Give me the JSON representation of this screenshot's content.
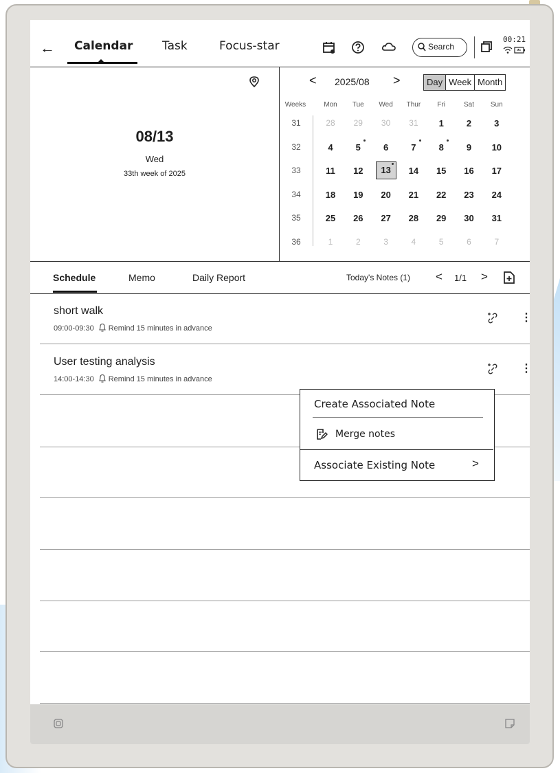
{
  "nav": {
    "back_glyph": "←",
    "tabs": [
      {
        "label": "Calendar",
        "active": true
      },
      {
        "label": "Task",
        "active": false
      },
      {
        "label": "Focus-star",
        "active": false
      }
    ],
    "icons": [
      "calendar-add-icon",
      "help-icon",
      "sync-cloud-icon"
    ],
    "search_label": "Search",
    "time": "00:21",
    "status_icons": [
      "wifi-icon",
      "battery-icon"
    ]
  },
  "selected_date": {
    "date": "08/13",
    "weekday": "Wed",
    "week_of": "33th week of 2025"
  },
  "calendar": {
    "month_label": "2025/08",
    "prev_glyph": "<",
    "next_glyph": ">",
    "views": [
      "Day",
      "Week",
      "Month"
    ],
    "active_view": "Day",
    "weeks_header": "Weeks",
    "dow": [
      "Mon",
      "Tue",
      "Wed",
      "Thur",
      "Fri",
      "Sat",
      "Sun"
    ],
    "rows": [
      {
        "week": "31",
        "days": [
          "28",
          "29",
          "30",
          "31",
          "1",
          "2",
          "3"
        ]
      },
      {
        "week": "32",
        "days": [
          "4",
          "5",
          "6",
          "7",
          "8",
          "9",
          "10"
        ]
      },
      {
        "week": "33",
        "days": [
          "11",
          "12",
          "13",
          "14",
          "15",
          "16",
          "17"
        ]
      },
      {
        "week": "34",
        "days": [
          "18",
          "19",
          "20",
          "21",
          "22",
          "23",
          "24"
        ]
      },
      {
        "week": "35",
        "days": [
          "25",
          "26",
          "27",
          "28",
          "29",
          "30",
          "31"
        ]
      },
      {
        "week": "36",
        "days": [
          "1",
          "2",
          "3",
          "4",
          "5",
          "6",
          "7"
        ]
      }
    ],
    "selected_day": "13"
  },
  "subtabs": {
    "items": [
      "Schedule",
      "Memo",
      "Daily Report"
    ],
    "active": "Schedule",
    "todays_notes": "Today's Notes (1)",
    "page": "1/1",
    "prev_glyph": "<",
    "next_glyph": ">"
  },
  "events": [
    {
      "title": "short walk",
      "time": "09:00-09:30",
      "reminder": "Remind 15 minutes in advance"
    },
    {
      "title": "User testing analysis",
      "time": "14:00-14:30",
      "reminder": "Remind 15 minutes in advance"
    }
  ],
  "context_menu": {
    "items": [
      "Create Associated Note",
      "Merge notes",
      "Associate Existing Note"
    ],
    "chevron": ">"
  },
  "more_glyph": "⋮"
}
